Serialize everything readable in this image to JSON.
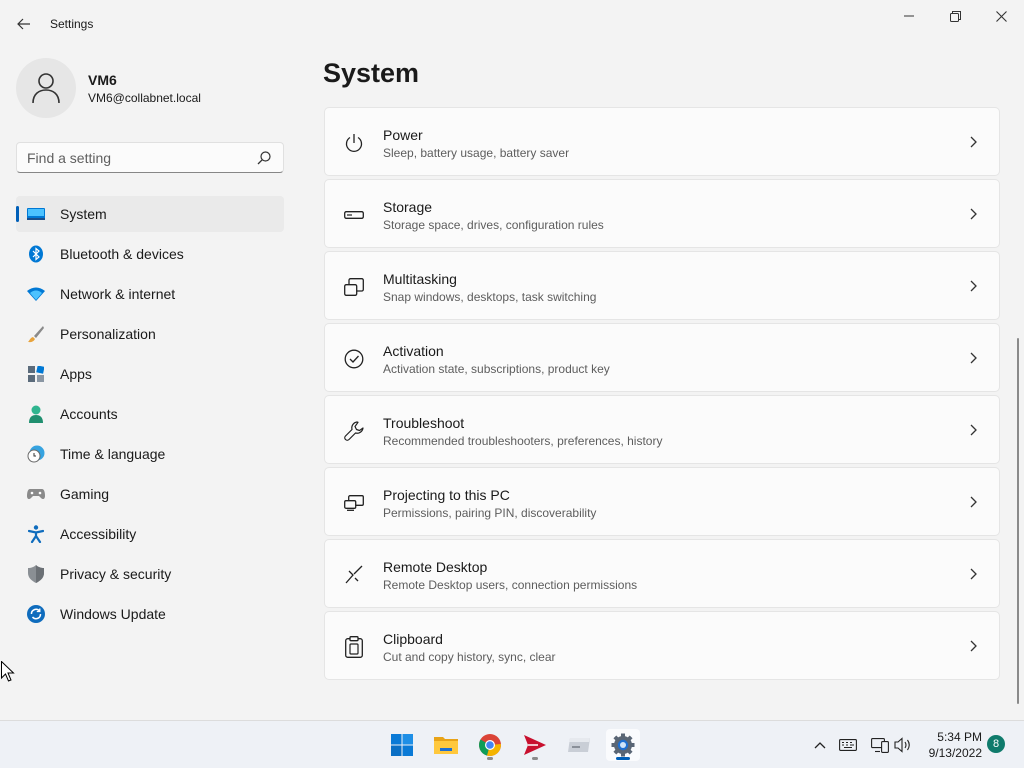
{
  "window": {
    "title": "Settings",
    "controls": [
      "minimize",
      "maximize",
      "close"
    ]
  },
  "profile": {
    "name": "VM6",
    "email": "VM6@collabnet.local"
  },
  "search": {
    "placeholder": "Find a setting"
  },
  "sidebar": {
    "items": [
      {
        "label": "System",
        "icon": "system-icon",
        "active": true
      },
      {
        "label": "Bluetooth & devices",
        "icon": "bluetooth-icon"
      },
      {
        "label": "Network & internet",
        "icon": "wifi-icon"
      },
      {
        "label": "Personalization",
        "icon": "brush-icon"
      },
      {
        "label": "Apps",
        "icon": "apps-icon"
      },
      {
        "label": "Accounts",
        "icon": "accounts-icon"
      },
      {
        "label": "Time & language",
        "icon": "clock-globe-icon"
      },
      {
        "label": "Gaming",
        "icon": "controller-icon"
      },
      {
        "label": "Accessibility",
        "icon": "accessibility-icon"
      },
      {
        "label": "Privacy & security",
        "icon": "shield-icon"
      },
      {
        "label": "Windows Update",
        "icon": "update-icon"
      }
    ]
  },
  "main": {
    "title": "System",
    "cards": [
      {
        "title": "Power",
        "desc": "Sleep, battery usage, battery saver",
        "icon": "power-icon"
      },
      {
        "title": "Storage",
        "desc": "Storage space, drives, configuration rules",
        "icon": "storage-icon"
      },
      {
        "title": "Multitasking",
        "desc": "Snap windows, desktops, task switching",
        "icon": "multitasking-icon"
      },
      {
        "title": "Activation",
        "desc": "Activation state, subscriptions, product key",
        "icon": "activation-icon"
      },
      {
        "title": "Troubleshoot",
        "desc": "Recommended troubleshooters, preferences, history",
        "icon": "wrench-icon"
      },
      {
        "title": "Projecting to this PC",
        "desc": "Permissions, pairing PIN, discoverability",
        "icon": "projecting-icon"
      },
      {
        "title": "Remote Desktop",
        "desc": "Remote Desktop users, connection permissions",
        "icon": "remote-desktop-icon"
      },
      {
        "title": "Clipboard",
        "desc": "Cut and copy history, sync, clear",
        "icon": "clipboard-icon"
      }
    ]
  },
  "taskbar": {
    "apps": [
      "start-icon",
      "file-explorer-icon",
      "chrome-icon",
      "send-app-icon",
      "drive-app-icon",
      "settings-gear-icon"
    ],
    "clock": {
      "time": "5:34 PM",
      "date": "9/13/2022"
    },
    "notifications": "8"
  },
  "colors": {
    "accent": "#005fb8",
    "background": "#f3f3f3",
    "card": "#fbfbfb"
  }
}
